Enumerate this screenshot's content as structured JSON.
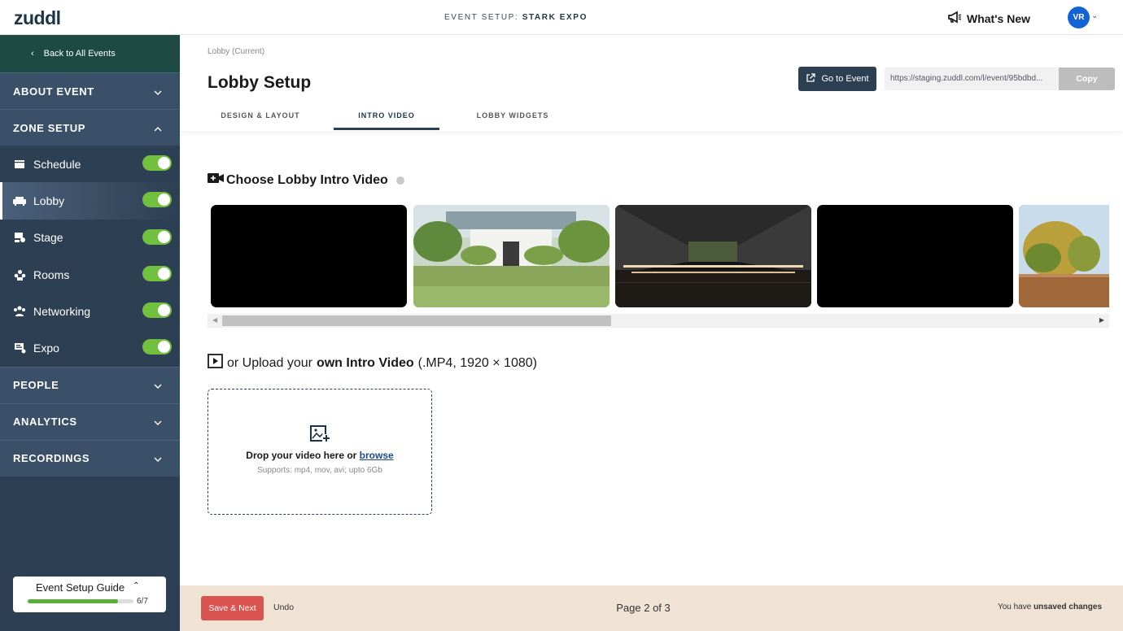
{
  "topbar": {
    "logo": "zuddl",
    "event_label": "EVENT SETUP:",
    "event_name": "STARK EXPO",
    "whats_new": "What's New",
    "avatar_initials": "VR"
  },
  "sidebar": {
    "back_label": "Back to All Events",
    "sections": {
      "about": "ABOUT EVENT",
      "zone": "ZONE SETUP",
      "people": "PEOPLE",
      "analytics": "ANALYTICS",
      "recordings": "RECORDINGS"
    },
    "items": [
      {
        "label": "Schedule",
        "icon": "calendar-icon",
        "enabled": true
      },
      {
        "label": "Lobby",
        "icon": "sofa-icon",
        "enabled": true
      },
      {
        "label": "Stage",
        "icon": "stage-icon",
        "enabled": true
      },
      {
        "label": "Rooms",
        "icon": "rooms-icon",
        "enabled": true
      },
      {
        "label": "Networking",
        "icon": "networking-icon",
        "enabled": true
      },
      {
        "label": "Expo",
        "icon": "expo-icon",
        "enabled": true
      }
    ],
    "active_item": "Lobby",
    "guide": {
      "title": "Event Setup Guide",
      "progress": "6/7",
      "progress_fraction": 0.857
    }
  },
  "header": {
    "breadcrumb": "Lobby (Current)",
    "title": "Lobby Setup",
    "go_event": "Go to Event",
    "url": "https://staging.zuddl.com/l/event/95bdbd...",
    "copy": "Copy",
    "tabs": [
      "DESIGN & LAYOUT",
      "INTRO VIDEO",
      "LOBBY WIDGETS"
    ],
    "active_tab": "INTRO VIDEO"
  },
  "content": {
    "choose_title": "Choose Lobby Intro Video",
    "upload_prefix": "or Upload your",
    "upload_bold": "own Intro Video",
    "upload_suffix": "(.MP4, 1920 × 1080)",
    "drop_text": "Drop your video here or",
    "browse": "browse",
    "supports": "Supports: mp4, mov, avi; upto 6Gb"
  },
  "footer": {
    "save": "Save & Next",
    "undo": "Undo",
    "page": "Page 2 of 3",
    "unsaved_prefix": "You have",
    "unsaved_bold": "unsaved changes"
  },
  "colors": {
    "sidebar": "#2d3f52",
    "accent_green": "#72c13e",
    "save_red": "#d9534f",
    "footer_bg": "#f1e3d4"
  }
}
